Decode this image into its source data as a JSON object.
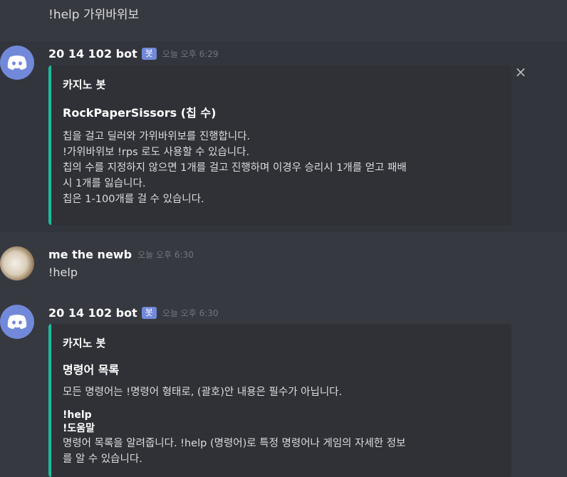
{
  "first_line": "!help 가위바위보",
  "messages": [
    {
      "username": "20 14 102 bot",
      "bot_tag": "봇",
      "timestamp": "오늘 오후 6:29",
      "embed": {
        "author": "카지노 봇",
        "title": "RockPaperSissors (칩 수)",
        "description_lines": [
          "칩을 걸고 딜러와 가위바위보를 진행합니다.",
          "!가위바위보 !rps 로도 사용할 수 있습니다.",
          "칩의 수를 지정하지 않으면 1개를 걸고 진행하며 이경우 승리시 1개를 얻고 패배",
          "시 1개를 잃습니다.",
          "칩은 1-100개를 걸 수 있습니다."
        ],
        "accent_color": "#1abc9c"
      },
      "close_icon": "×"
    },
    {
      "username": "me the newb",
      "timestamp": "오늘 오후 6:30",
      "text": "!help"
    },
    {
      "username": "20 14 102 bot",
      "bot_tag": "봇",
      "timestamp": "오늘 오후 6:30",
      "embed": {
        "author": "카지노 봇",
        "title": "명령어 목록",
        "description": "모든 명령어는 !명령어 형태로, (괄호)안 내용은 필수가 아닙니다.",
        "field_names": [
          "!help",
          "!도움말"
        ],
        "field_value_lines": [
          "명령어 목록을 알려줍니다. !help (명령어)로 특정 명령어나 게임의 자세한 정보",
          "를 알 수 있습니다."
        ],
        "accent_color": "#1abc9c"
      }
    }
  ],
  "colors": {
    "background": "#36393f",
    "embed_bg": "#2f3136",
    "blurple": "#7289da",
    "timestamp": "#72767d"
  }
}
